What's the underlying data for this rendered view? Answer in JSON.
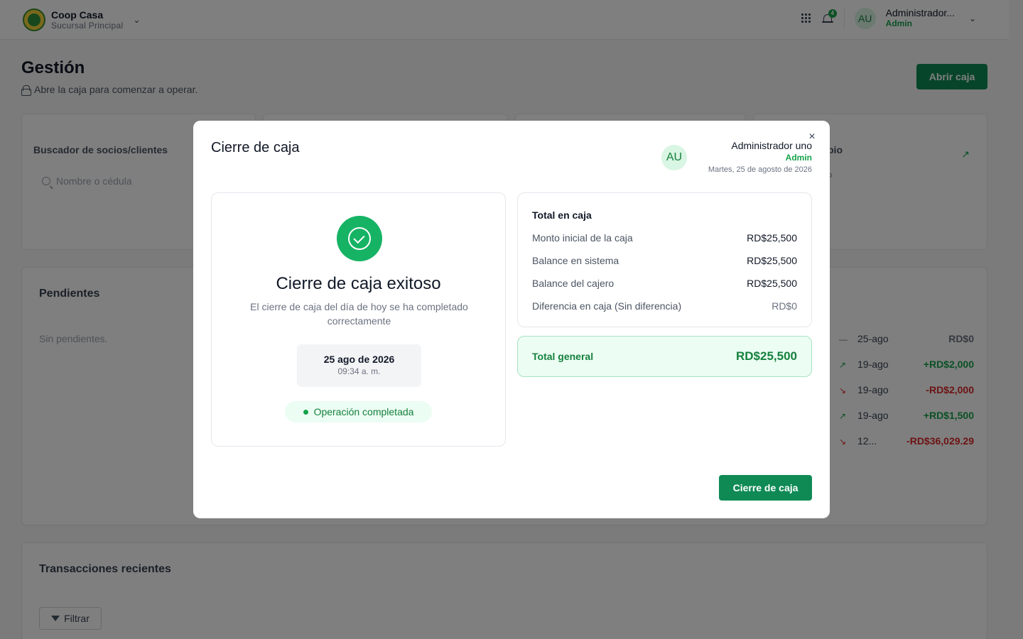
{
  "header": {
    "org_name": "Coop Casa",
    "org_branch": "Sucursal Principal",
    "notification_count": "4",
    "user_initials": "AU",
    "user_name": "Administrador...",
    "user_role": "Admin"
  },
  "page": {
    "title": "Gestión",
    "subtitle": "Abre la caja para comenzar a operar.",
    "open_button": "Abrir caja"
  },
  "search": {
    "label": "Buscador de socios/clientes",
    "placeholder": "Nombre o cédula"
  },
  "side_card": {
    "label_partial": "bio",
    "sub_partial": "o"
  },
  "pending": {
    "title": "Pendientes",
    "empty_text": "Sin pendientes."
  },
  "transactions_partial": [
    {
      "icon": "—",
      "date": "25-ago",
      "amount": "RD$0",
      "kind": "neutral"
    },
    {
      "icon": "↗",
      "date": "19-ago",
      "amount": "+RD$2,000",
      "kind": "pos"
    },
    {
      "icon": "↘",
      "date": "19-ago",
      "amount": "-RD$2,000",
      "kind": "neg"
    },
    {
      "icon": "↗",
      "date": "19-ago",
      "amount": "+RD$1,500",
      "kind": "pos"
    },
    {
      "icon": "↘",
      "date": "12...",
      "amount": "-RD$36,029.29",
      "kind": "neg"
    }
  ],
  "recent": {
    "title": "Transacciones recientes",
    "filter_label": "Filtrar"
  },
  "modal": {
    "title": "Cierre de caja",
    "close_symbol": "×",
    "user_initials": "AU",
    "user_name": "Administrador uno",
    "user_role": "Admin",
    "date_long": "Martes, 25 de agosto de 2026",
    "success_title": "Cierre de caja exitoso",
    "success_desc": "El cierre de caja del día de hoy se ha completado correctamente",
    "date_short": "25 ago de 2026",
    "time": "09:34 a. m.",
    "status": "Operación completada",
    "summary_title": "Total en caja",
    "summary_rows": [
      {
        "label": "Monto inicial de la caja",
        "value": "RD$25,500"
      },
      {
        "label": "Balance en sistema",
        "value": "RD$25,500"
      },
      {
        "label": "Balance del cajero",
        "value": "RD$25,500"
      },
      {
        "label": "Diferencia en caja (Sin diferencia)",
        "value": "RD$0"
      }
    ],
    "total_label": "Total general",
    "total_value": "RD$25,500",
    "confirm_button": "Cierre de caja"
  },
  "colors": {
    "brand_green": "#0f8a55",
    "success_green": "#16b364",
    "negative_red": "#dc2626"
  }
}
